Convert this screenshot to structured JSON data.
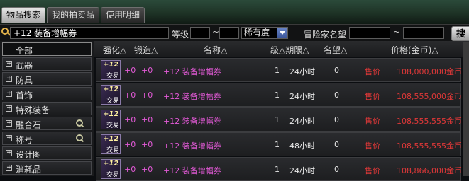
{
  "tabs": [
    {
      "label": "物品搜索"
    },
    {
      "label": "我的拍卖品"
    },
    {
      "label": "使用明细"
    }
  ],
  "search": {
    "value": "+12 装备增幅券",
    "level_label": "等级",
    "level_tilde": "~",
    "rarity_value": "稀有度",
    "adventurer_label": "冒险家名望",
    "fame_tilde": "~",
    "search_button": "搜"
  },
  "sidebar": {
    "items": [
      {
        "label": "全部",
        "icon": "none"
      },
      {
        "label": "武器",
        "icon": "plus-icon"
      },
      {
        "label": "防具",
        "icon": "plus-icon"
      },
      {
        "label": "首饰",
        "icon": "plus-icon"
      },
      {
        "label": "特殊装备",
        "icon": "plus-icon"
      },
      {
        "label": "融合石",
        "icon": "plus-icon"
      },
      {
        "label": "称号",
        "icon": "plus-icon"
      },
      {
        "label": "设计图",
        "icon": "plus-icon"
      },
      {
        "label": "消耗品",
        "icon": "plus-icon"
      }
    ]
  },
  "columns": {
    "enhance": "强化△",
    "forge": "锻造△",
    "name": "名称△",
    "level_limit": "级△期限△",
    "fame": "名望△",
    "price": "价格(金币)△"
  },
  "rows": [
    {
      "icon_level": "+12",
      "icon_text": "交易",
      "enhance": "+0",
      "forge": "+0",
      "name": "+12  装备增幅券",
      "level": "1",
      "duration": "24小时",
      "fame": "0",
      "price_label": "售价",
      "price": "108,000,000金币"
    },
    {
      "icon_level": "+12",
      "icon_text": "交易",
      "enhance": "+0",
      "forge": "+0",
      "name": "+12  装备增幅券",
      "level": "1",
      "duration": "24小时",
      "fame": "0",
      "price_label": "售价",
      "price": "108,555,000金币"
    },
    {
      "icon_level": "+12",
      "icon_text": "交易",
      "enhance": "+0",
      "forge": "+0",
      "name": "+12  装备增幅券",
      "level": "1",
      "duration": "24小时",
      "fame": "0",
      "price_label": "售价",
      "price": "108,555,555金币"
    },
    {
      "icon_level": "+12",
      "icon_text": "交易",
      "enhance": "+0",
      "forge": "+0",
      "name": "+12  装备增幅券",
      "level": "1",
      "duration": "48小时",
      "fame": "0",
      "price_label": "售价",
      "price": "108,555,555金币"
    },
    {
      "icon_level": "+12",
      "icon_text": "交易",
      "enhance": "+0",
      "forge": "+0",
      "name": "+12  装备增幅券",
      "level": "1",
      "duration": "24小时",
      "fame": "0",
      "price_label": "售价",
      "price": "108,866,000金币"
    }
  ]
}
